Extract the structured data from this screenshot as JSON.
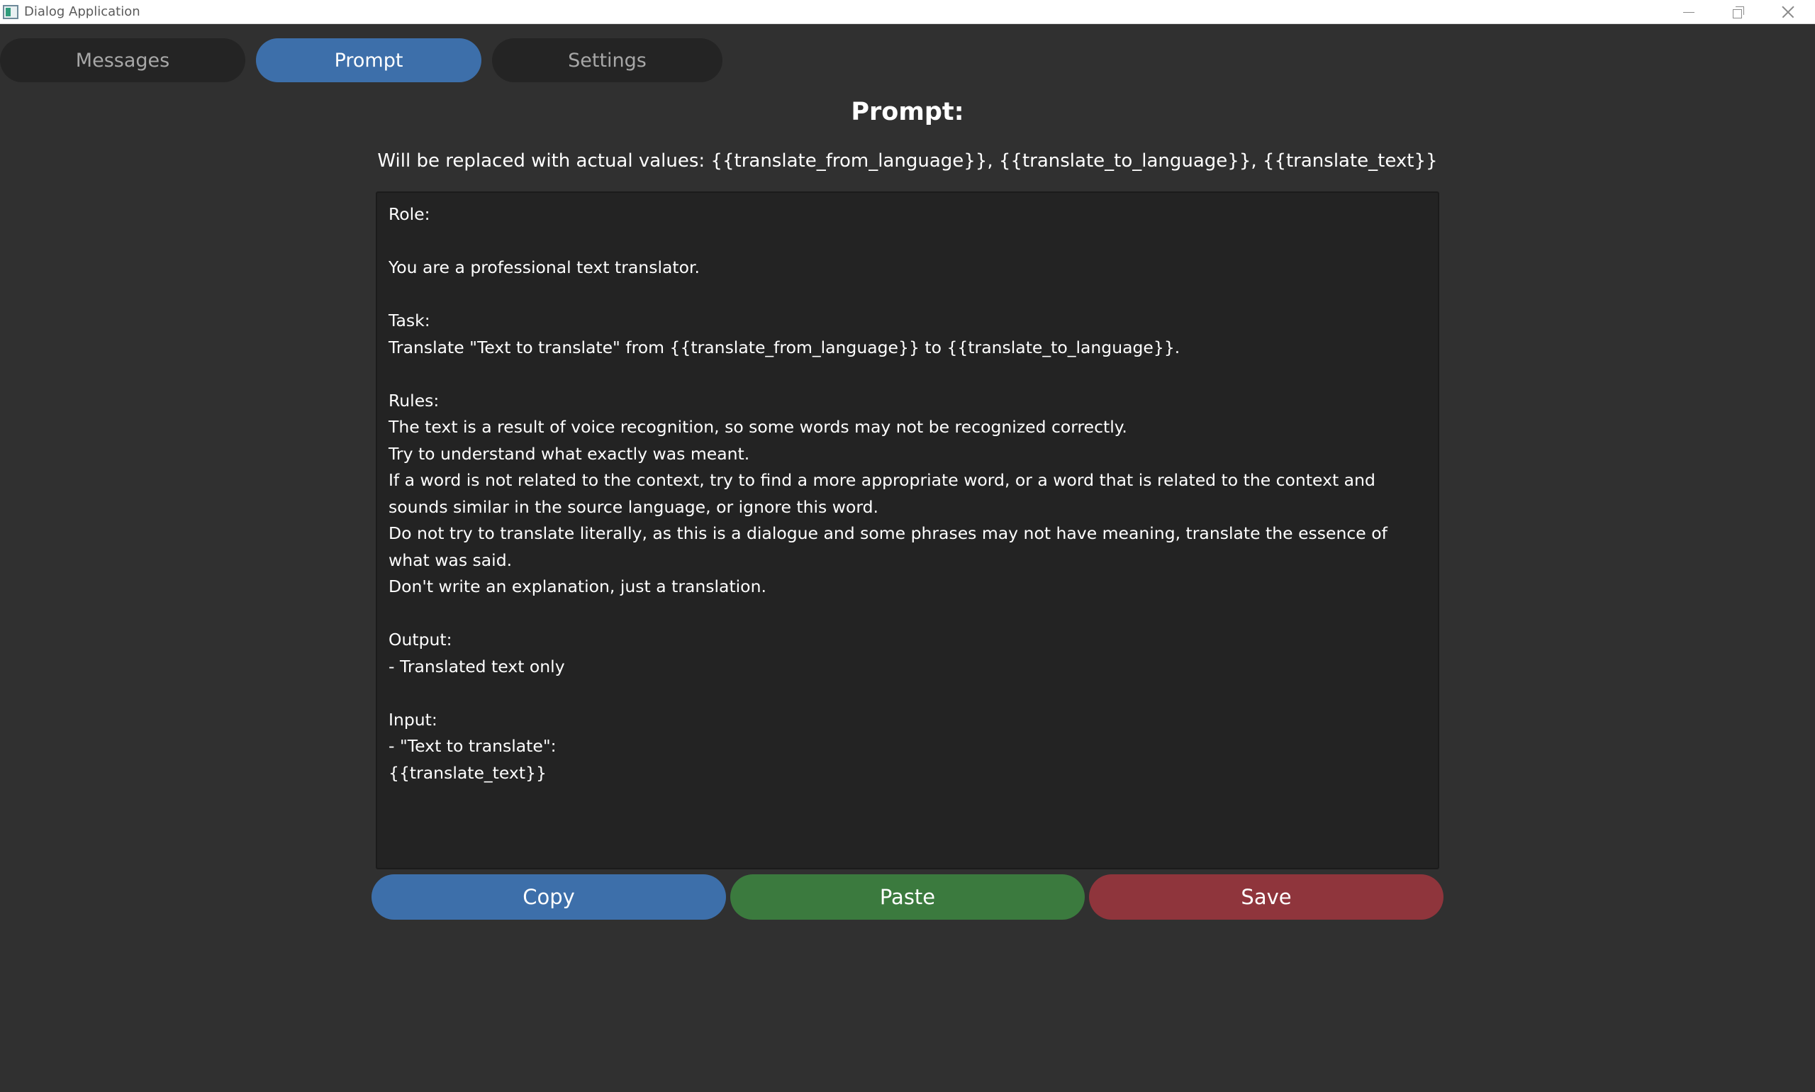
{
  "window": {
    "title": "Dialog Application",
    "icon": "app-window-icon",
    "controls": [
      "minimize-icon",
      "maximize-icon",
      "close-icon"
    ]
  },
  "tabs": [
    {
      "label": "Messages",
      "active": false
    },
    {
      "label": "Prompt",
      "active": true
    },
    {
      "label": "Settings",
      "active": false
    }
  ],
  "main": {
    "heading": "Prompt:",
    "subheading": "Will be replaced with actual values: {{translate_from_language}}, {{translate_to_language}}, {{translate_text}}",
    "prompt_text": "Role:\n\nYou are a professional text translator.\n\nTask:\nTranslate \"Text to translate\" from {{translate_from_language}} to {{translate_to_language}}.\n\nRules:\nThe text is a result of voice recognition, so some words may not be recognized correctly.\nTry to understand what exactly was meant.\nIf a word is not related to the context, try to find a more appropriate word, or a word that is related to the context and sounds similar in the source language, or ignore this word.\nDo not try to translate literally, as this is a dialogue and some phrases may not have meaning, translate the essence of what was said.\nDon't write an explanation, just a translation.\n\nOutput:\n- Translated text only\n\nInput:\n- \"Text to translate\":\n{{translate_text}}"
  },
  "actions": {
    "copy_label": "Copy",
    "paste_label": "Paste",
    "save_label": "Save"
  },
  "colors": {
    "background": "#303030",
    "editor_background": "#232323",
    "tab_inactive": "#242424",
    "accent_blue": "#3d6faa",
    "accent_green": "#3b7a3e",
    "accent_red": "#8f353c"
  }
}
